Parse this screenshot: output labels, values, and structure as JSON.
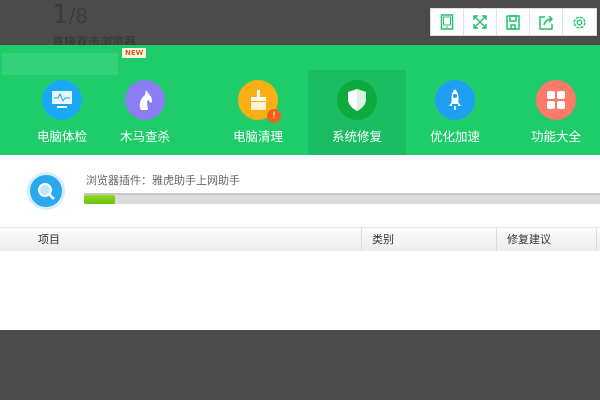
{
  "background": {
    "pager_current": "1",
    "pager_total": "/8",
    "hint": "直接双击浏览器"
  },
  "toolbar": {
    "icons": [
      "tablet-icon",
      "fullscreen-icon",
      "save-icon",
      "share-icon",
      "settings-icon"
    ]
  },
  "header": {
    "new_badge": "NEW"
  },
  "nav": [
    {
      "label": "电脑体检",
      "icon": "monitor-icon",
      "color": "#1aa7f5"
    },
    {
      "label": "木马查杀",
      "icon": "horse-icon",
      "color": "#8c7cf5"
    },
    {
      "label": "电脑清理",
      "icon": "broom-icon",
      "color": "#fdae15",
      "badge": "!"
    },
    {
      "label": "系统修复",
      "icon": "shield-icon",
      "color": "#0daa3e",
      "selected": true
    },
    {
      "label": "优化加速",
      "icon": "rocket-icon",
      "color": "#1e9ff2"
    },
    {
      "label": "功能大全",
      "icon": "grid-icon",
      "color": "#fb7a6a"
    }
  ],
  "scan": {
    "status": "浏览器插件：雅虎助手上网助手",
    "progress_percent": 6
  },
  "table": {
    "columns": [
      "项目",
      "类别",
      "修复建议"
    ]
  }
}
